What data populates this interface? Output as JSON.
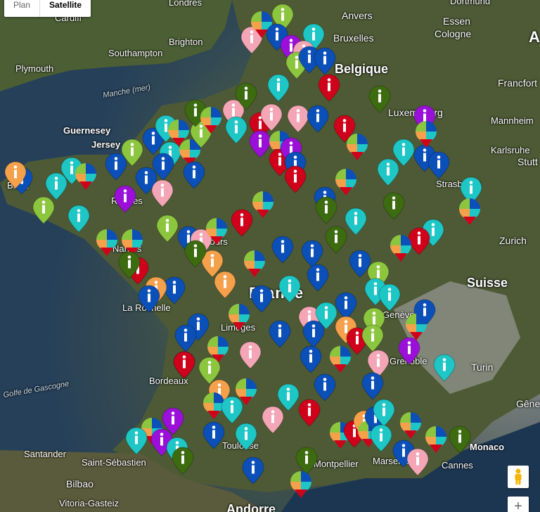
{
  "map_controls": {
    "tabs": [
      {
        "label": "Plan",
        "active": false
      },
      {
        "label": "Satellite",
        "active": true
      }
    ],
    "pegman_icon": "pegman-icon",
    "zoom_in_label": "+"
  },
  "labels": {
    "londres": "Londres",
    "cardiff": "Cardiff",
    "brighton": "Brighton",
    "southampton": "Southampton",
    "plymouth": "Plymouth",
    "manche": "Manche (mer)",
    "guernesey": "Guernesey",
    "jersey": "Jersey",
    "brest": "Brest",
    "rennes": "Rennes",
    "nantes": "Nantes",
    "tours": "Tours",
    "la_rochelle": "La Rochelle",
    "limoges": "Limoges",
    "bordeaux": "Bordeaux",
    "golfe": "Golfe de Gascogne",
    "toulouse": "Toulouse",
    "montpellier": "Montpellier",
    "marseille": "Marseille",
    "cannes": "Cannes",
    "monaco": "Monaco",
    "santander": "Santander",
    "saint_sebastien": "Saint-Sébastien",
    "bilbao": "Bilbao",
    "vitoria": "Vitoria-Gasteiz",
    "andorre": "Andorre",
    "france": "France",
    "belgique": "Belgique",
    "anvers": "Anvers",
    "bruxelles": "Bruxelles",
    "dortmund": "Dortmund",
    "essen": "Essen",
    "cologne": "Cologne",
    "francfort": "Francfort",
    "mannheim": "Mannheim",
    "karlsruhe": "Karlsruhe",
    "stuttgart": "Stutt",
    "luxembourg": "Luxembourg",
    "strasbourg": "Strasbourg",
    "zurich": "Zurich",
    "suisse": "Suisse",
    "geneve": "Genève",
    "grenoble": "Grenoble",
    "turin": "Turin",
    "genes": "Gêne",
    "allemagne": "A"
  },
  "marker_colors": {
    "blue": "#0b4fb8",
    "cyan": "#1ec6c6",
    "green": "#8cc63f",
    "dkgreen": "#3d6b10",
    "red": "#d0021b",
    "pink": "#f4a6b6",
    "orange": "#f5a04a",
    "purple": "#9b10d8"
  },
  "marker_icon": "info-marker-icon",
  "multi_marker_icon": "multi-category-marker-icon",
  "markers": [
    [
      "blue",
      31,
      258
    ],
    [
      "orange",
      22,
      250
    ],
    [
      "cyan",
      80,
      266
    ],
    [
      "green",
      62,
      300
    ],
    [
      "cyan",
      102,
      244
    ],
    [
      "multi",
      122,
      252
    ],
    [
      "blue",
      165,
      238
    ],
    [
      "green",
      188,
      218
    ],
    [
      "blue",
      218,
      202
    ],
    [
      "cyan",
      236,
      184
    ],
    [
      "multi",
      254,
      190
    ],
    [
      "cyan",
      242,
      222
    ],
    [
      "blue",
      232,
      238
    ],
    [
      "multi",
      270,
      218
    ],
    [
      "green",
      286,
      192
    ],
    [
      "dkgreen",
      278,
      162
    ],
    [
      "multi",
      300,
      172
    ],
    [
      "pink",
      332,
      162
    ],
    [
      "cyan",
      336,
      186
    ],
    [
      "red",
      370,
      180
    ],
    [
      "pink",
      386,
      168
    ],
    [
      "purple",
      370,
      206
    ],
    [
      "multi",
      398,
      206
    ],
    [
      "red",
      398,
      232
    ],
    [
      "purple",
      414,
      216
    ],
    [
      "blue",
      420,
      236
    ],
    [
      "red",
      420,
      256
    ],
    [
      "pink",
      424,
      170
    ],
    [
      "blue",
      452,
      170
    ],
    [
      "red",
      490,
      184
    ],
    [
      "multi",
      508,
      210
    ],
    [
      "blue",
      208,
      258
    ],
    [
      "blue",
      276,
      250
    ],
    [
      "pink",
      231,
      276
    ],
    [
      "purple",
      178,
      284
    ],
    [
      "cyan",
      112,
      312
    ],
    [
      "multi",
      152,
      346
    ],
    [
      "multi",
      188,
      346
    ],
    [
      "green",
      238,
      326
    ],
    [
      "blue",
      268,
      342
    ],
    [
      "pink",
      286,
      346
    ],
    [
      "multi",
      308,
      330
    ],
    [
      "red",
      344,
      318
    ],
    [
      "multi",
      374,
      292
    ],
    [
      "blue",
      462,
      286
    ],
    [
      "dkgreen",
      464,
      300
    ],
    [
      "cyan",
      506,
      316
    ],
    [
      "dkgreen",
      478,
      342
    ],
    [
      "multi",
      492,
      260
    ],
    [
      "dkgreen",
      560,
      294
    ],
    [
      "cyan",
      552,
      246
    ],
    [
      "cyan",
      574,
      218
    ],
    [
      "blue",
      604,
      226
    ],
    [
      "blue",
      624,
      236
    ],
    [
      "purple",
      604,
      170
    ],
    [
      "multi",
      606,
      192
    ],
    [
      "dkgreen",
      540,
      142
    ],
    [
      "red",
      468,
      126
    ],
    [
      "cyan",
      396,
      126
    ],
    [
      "dkgreen",
      350,
      138
    ],
    [
      "pink",
      358,
      58
    ],
    [
      "multi",
      372,
      36
    ],
    [
      "green",
      402,
      26
    ],
    [
      "blue",
      394,
      54
    ],
    [
      "cyan",
      446,
      54
    ],
    [
      "purple",
      414,
      70
    ],
    [
      "pink",
      432,
      78
    ],
    [
      "green",
      422,
      94
    ],
    [
      "blue",
      440,
      86
    ],
    [
      "blue",
      462,
      88
    ],
    [
      "cyan",
      670,
      272
    ],
    [
      "multi",
      668,
      302
    ],
    [
      "cyan",
      616,
      332
    ],
    [
      "red",
      596,
      344
    ],
    [
      "multi",
      570,
      354
    ],
    [
      "blue",
      512,
      376
    ],
    [
      "blue",
      402,
      356
    ],
    [
      "blue",
      444,
      362
    ],
    [
      "green",
      538,
      392
    ],
    [
      "cyan",
      534,
      416
    ],
    [
      "cyan",
      554,
      424
    ],
    [
      "blue",
      452,
      396
    ],
    [
      "multi",
      362,
      376
    ],
    [
      "orange",
      302,
      376
    ],
    [
      "dkgreen",
      278,
      362
    ],
    [
      "orange",
      320,
      406
    ],
    [
      "cyan",
      412,
      412
    ],
    [
      "blue",
      372,
      426
    ],
    [
      "blue",
      248,
      414
    ],
    [
      "orange",
      222,
      414
    ],
    [
      "blue",
      212,
      426
    ],
    [
      "red",
      196,
      386
    ],
    [
      "dkgreen",
      184,
      378
    ],
    [
      "pink",
      440,
      456
    ],
    [
      "cyan",
      464,
      450
    ],
    [
      "blue",
      492,
      436
    ],
    [
      "multi",
      340,
      452
    ],
    [
      "blue",
      282,
      466
    ],
    [
      "blue",
      264,
      482
    ],
    [
      "blue",
      398,
      476
    ],
    [
      "blue",
      446,
      476
    ],
    [
      "orange",
      492,
      470
    ],
    [
      "green",
      532,
      458
    ],
    [
      "red",
      508,
      486
    ],
    [
      "green",
      530,
      482
    ],
    [
      "blue",
      604,
      446
    ],
    [
      "multi",
      592,
      466
    ],
    [
      "purple",
      582,
      500
    ],
    [
      "blue",
      262,
      520
    ],
    [
      "red",
      262,
      520
    ],
    [
      "multi",
      310,
      498
    ],
    [
      "green",
      298,
      528
    ],
    [
      "pink",
      356,
      506
    ],
    [
      "blue",
      442,
      512
    ],
    [
      "multi",
      484,
      512
    ],
    [
      "pink",
      538,
      518
    ],
    [
      "cyan",
      632,
      524
    ],
    [
      "blue",
      530,
      550
    ],
    [
      "blue",
      462,
      552
    ],
    [
      "cyan",
      410,
      566
    ],
    [
      "multi",
      350,
      558
    ],
    [
      "orange",
      312,
      560
    ],
    [
      "multi",
      304,
      578
    ],
    [
      "cyan",
      330,
      584
    ],
    [
      "red",
      440,
      588
    ],
    [
      "pink",
      388,
      598
    ],
    [
      "purple",
      246,
      600
    ],
    [
      "multi",
      216,
      614
    ],
    [
      "purple",
      230,
      630
    ],
    [
      "cyan",
      194,
      628
    ],
    [
      "cyan",
      252,
      642
    ],
    [
      "dkgreen",
      260,
      656
    ],
    [
      "blue",
      304,
      620
    ],
    [
      "cyan",
      350,
      622
    ],
    [
      "blue",
      360,
      670
    ],
    [
      "dkgreen",
      436,
      656
    ],
    [
      "multi",
      428,
      690
    ],
    [
      "multi",
      484,
      620
    ],
    [
      "red",
      504,
      618
    ],
    [
      "orange",
      518,
      604
    ],
    [
      "multi",
      524,
      618
    ],
    [
      "blue",
      534,
      598
    ],
    [
      "cyan",
      546,
      588
    ],
    [
      "cyan",
      542,
      624
    ],
    [
      "multi",
      584,
      606
    ],
    [
      "multi",
      620,
      626
    ],
    [
      "dkgreen",
      654,
      626
    ],
    [
      "blue",
      574,
      646
    ],
    [
      "pink",
      594,
      658
    ]
  ]
}
